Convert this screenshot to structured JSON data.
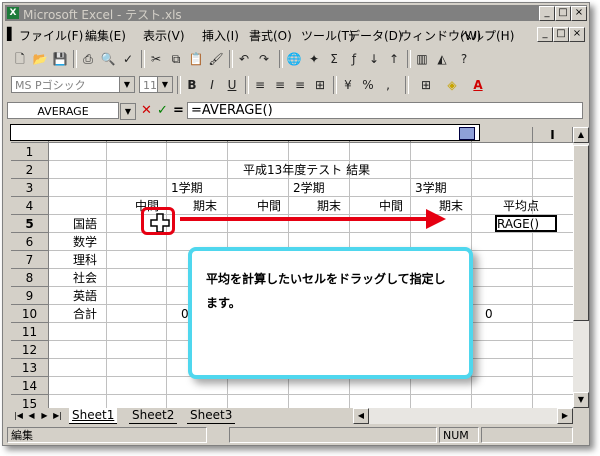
{
  "window": {
    "title": "Microsoft Excel - テスト.xls",
    "app_icon": "X",
    "controls": [
      "_",
      "□",
      "×"
    ]
  },
  "menu": {
    "items": [
      "ファイル(F)",
      "編集(E)",
      "表示(V)",
      "挿入(I)",
      "書式(O)",
      "ツール(T)",
      "データ(D)",
      "ウィンドウ(W)",
      "ヘルプ(H)"
    ],
    "doc_controls": [
      "_",
      "□",
      "×"
    ]
  },
  "format_toolbar": {
    "font_name": "MS Pゴシック",
    "font_size": "11",
    "bold": "B",
    "italic": "I",
    "underline": "U",
    "percent": "%",
    "comma": ","
  },
  "formula_bar": {
    "name_box": "AVERAGE",
    "cancel": "✕",
    "enter": "✓",
    "equals": "=",
    "formula": "=AVERAGE()"
  },
  "sheet": {
    "column_last": "I",
    "rows": [
      "1",
      "2",
      "3",
      "4",
      "5",
      "6",
      "7",
      "8",
      "9",
      "10",
      "11",
      "12",
      "13",
      "14",
      "15"
    ],
    "active_row": "5",
    "title": "平成13年度テスト 結果",
    "terms": [
      "1学期",
      "2学期",
      "3学期"
    ],
    "sub_headers": [
      "中間",
      "期末",
      "中間",
      "期末",
      "中間",
      "期末"
    ],
    "average_header": "平均点",
    "subjects": [
      "国語",
      "数学",
      "理科",
      "社会",
      "英語",
      "合計"
    ],
    "totals": [
      "0",
      "0"
    ],
    "active_cell_text": "RAGE()"
  },
  "tabs": [
    "Sheet1",
    "Sheet2",
    "Sheet3"
  ],
  "status": {
    "mode": "編集",
    "num": "NUM"
  },
  "callout": {
    "text": "平均を計算したいセルをドラッグして指定します。",
    "border_color": "#4fd7ee"
  },
  "colors": {
    "highlight_red": "#e60012",
    "titlebar": "#808080",
    "chrome": "#d4d0c8"
  }
}
